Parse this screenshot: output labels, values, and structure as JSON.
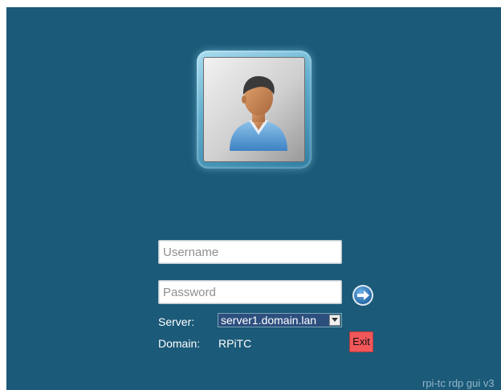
{
  "login": {
    "username_placeholder": "Username",
    "password_placeholder": "Password",
    "server_label": "Server:",
    "server_selected": "server1.domain.lan",
    "domain_label": "Domain:",
    "domain_value": "RPiTC",
    "exit_label": "Exit"
  },
  "footer": {
    "version_text": "rpi-tc rdp gui v3"
  },
  "icons": {
    "avatar": "user-avatar-icon",
    "go": "arrow-right-circle-icon",
    "dropdown": "chevron-down-icon"
  },
  "colors": {
    "background": "#1b5a78",
    "exit_button": "#f2575a",
    "go_button": "#2f7fc4"
  }
}
